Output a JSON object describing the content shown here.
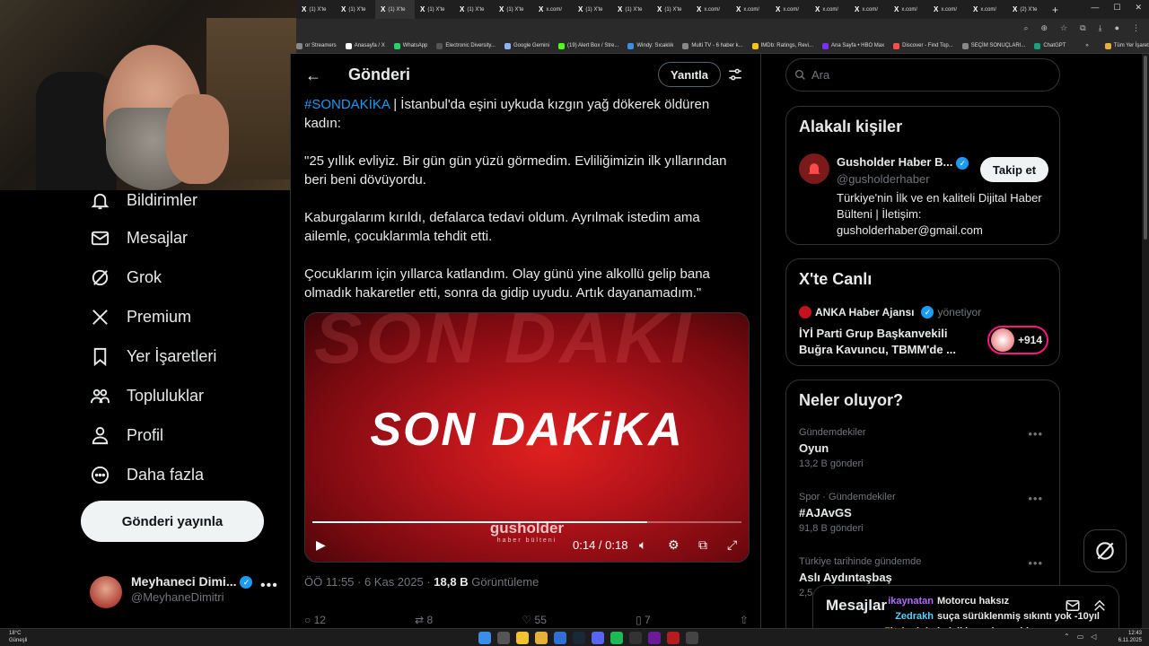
{
  "browser": {
    "tabs": [
      "(1) X'te",
      "(1) X'te",
      "(1) X'te",
      "(1) X'te",
      "(1) X'te",
      "(1) X'te",
      "x.com/",
      "(1) X'te",
      "(1) X'te",
      "(1) X'te",
      "x.com/",
      "x.com/",
      "x.com/",
      "x.com/",
      "x.com/",
      "x.com/",
      "x.com/",
      "x.com/",
      "(2) X'te"
    ],
    "new_tab": "+",
    "bookmarks": [
      "or Streamers",
      "Anasayfa / X",
      "WhatsApp",
      "Electronic Diversity...",
      "Google Gemini",
      "(19) Alert Box / Stre...",
      "Windy: Sıcaklık",
      "Multi TV - 6 haber k...",
      "IMDb: Ratings, Revi...",
      "Ana Sayfa • HBO Max",
      "Discover - Find Top...",
      "SEÇİM SONUÇLARI...",
      "ChatGPT",
      "»",
      "Tüm Yer İşaretleri"
    ]
  },
  "nav": {
    "items": [
      {
        "label": "Bildirimler",
        "icon": "bell-icon"
      },
      {
        "label": "Mesajlar",
        "icon": "mail-icon"
      },
      {
        "label": "Grok",
        "icon": "grok-icon"
      },
      {
        "label": "Premium",
        "icon": "x-logo-icon"
      },
      {
        "label": "Yer İşaretleri",
        "icon": "bookmark-icon"
      },
      {
        "label": "Topluluklar",
        "icon": "people-icon"
      },
      {
        "label": "Profil",
        "icon": "person-icon"
      },
      {
        "label": "Daha fazla",
        "icon": "more-circle-icon"
      }
    ],
    "post_button": "Gönderi yayınla",
    "account": {
      "name": "Meyhaneci Dimi...",
      "handle": "@MeyhaneDimitri",
      "more": "•••"
    }
  },
  "main": {
    "back": "←",
    "title": "Gönderi",
    "reply_button": "Yanıtla",
    "tweet": {
      "hashtag": "#SONDAKİKA",
      "line1_rest": " | İstanbul'da eşini uykuda kızgın yağ dökerek öldüren kadın:",
      "para2": "\"25 yıllık evliyiz. Bir gün gün yüzü görmedim. Evliliğimizin ilk yıllarından beri beni dövüyordu.",
      "para3": "Kaburgalarım kırıldı, defalarca tedavi oldum. Ayrılmak istedim ama ailemle, çocuklarımla tehdit etti.",
      "para4": "Çocuklarım için yıllarca katlandım. Olay günü yine alkollü gelip bana olmadık hakaretler etti, sonra da gidip uyudu. Artık dayanamadım.\""
    },
    "video": {
      "bg_text": "SON DAKİ",
      "headline": "SON DAKiKA",
      "logo": "gusholder",
      "logo_sub": "haber bülteni",
      "time": "0:14 / 0:18",
      "progress": 0.78
    },
    "meta": {
      "time": "ÖÖ 11:55 · 6 Kas 2025 · ",
      "views": "18,8 B",
      "views_label": " Görüntüleme"
    },
    "actions": {
      "replies": "12",
      "reposts": "8",
      "likes": "55",
      "bookmarks": "7"
    }
  },
  "sidebar": {
    "search_placeholder": "Ara",
    "related": {
      "title": "Alakalı kişiler",
      "name": "Gusholder Haber B...",
      "handle": "@gusholderhaber",
      "bio": "Türkiye'nin İlk ve en kaliteli Dijital Haber Bülteni | İletişim: gusholderhaber@gmail.com",
      "follow": "Takip et"
    },
    "live": {
      "title": "X'te Canlı",
      "host": "ANKA Haber Ajansı",
      "host_suffix": "yönetiyor",
      "text": "İYİ Parti Grup Başkanvekili Buğra Kavuncu, TBMM'de ...",
      "listeners": "+914"
    },
    "trends": {
      "title": "Neler oluyor?",
      "items": [
        {
          "category": "Gündemdekiler",
          "topic": "Oyun",
          "count": "13,2 B gönderi"
        },
        {
          "category": "Spor · Gündemdekiler",
          "topic": "#AJAvGS",
          "count": "91,8 B gönderi"
        },
        {
          "category": "Türkiye tarihinde gündemde",
          "topic": "Aslı Aydıntaşbaş",
          "count": "2,5"
        }
      ]
    },
    "messages_title": "Mesajlar"
  },
  "chat_overlay": [
    {
      "user": "ikaynatan",
      "user_color": "#b36bff",
      "text": "Motorcu haksız"
    },
    {
      "user": "Zedrakh",
      "user_color": "#5ad1ff",
      "text": "suça sürüklenmiş sıkıntı yok -10yıl"
    },
    {
      "user": "7balonjoje",
      "user_color": "#ffd23f",
      "text": "helali hoş olsun ablam"
    }
  ],
  "taskbar": {
    "weather_temp": "18°C",
    "weather_desc": "Güneşli",
    "time": "12:43",
    "date": "6.11.2025"
  }
}
